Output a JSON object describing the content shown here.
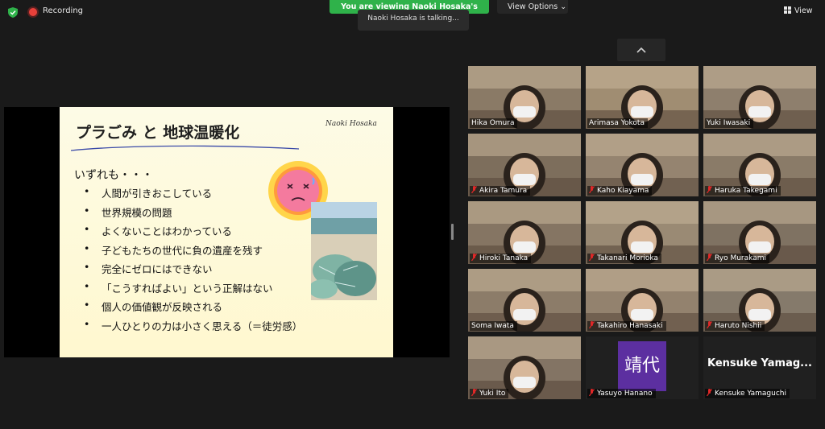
{
  "topbar": {
    "recording_label": "Recording",
    "banner_text": "You are viewing Naoki Hosaka's screen",
    "talking_text": "Naoki Hosaka is talking...",
    "view_options_label": "View Options ⌄",
    "view_label": "View"
  },
  "slide": {
    "title": "プラごみ と 地球温暖化",
    "author": "Naoki Hosaka",
    "lead": "いずれも・・・",
    "bullets": [
      "人間が引きおこしている",
      "世界規模の問題",
      "よくないことはわかっている",
      "子どもたちの世代に負の遺産を残す",
      "完全にゼロにはできない",
      "「こうすればよい」という正解はない",
      "個人の価値観が反映される",
      "一人ひとりの力は小さく思える（＝徒労感）"
    ]
  },
  "participants": [
    {
      "name": "Hika Omura",
      "muted": false
    },
    {
      "name": "Arimasa Yokota",
      "muted": false
    },
    {
      "name": "Yuki Iwasaki",
      "muted": false
    },
    {
      "name": "Akira Tamura",
      "muted": true
    },
    {
      "name": "Kaho Kiayama",
      "muted": true
    },
    {
      "name": "Haruka Takegami",
      "muted": true
    },
    {
      "name": "Hiroki Tanaka",
      "muted": true
    },
    {
      "name": "Takanari Morioka",
      "muted": true
    },
    {
      "name": "Ryo Murakami",
      "muted": true
    },
    {
      "name": "Soma Iwata",
      "muted": false
    },
    {
      "name": "Takahiro Hanasaki",
      "muted": true
    },
    {
      "name": "Haruto Nishii",
      "muted": true
    },
    {
      "name": "Yuki Ito",
      "muted": true
    },
    {
      "name": "Yasuyo Hanano",
      "muted": true,
      "avatar_text": "靖代",
      "avatar_color": "#5c2fa0"
    },
    {
      "name": "Kensuke Yamaguchi",
      "muted": true,
      "big_name": "Kensuke  Yamag..."
    }
  ],
  "colors": {
    "banner": "#2fb24a",
    "recording": "#e8403a",
    "mute": "#e02828"
  }
}
